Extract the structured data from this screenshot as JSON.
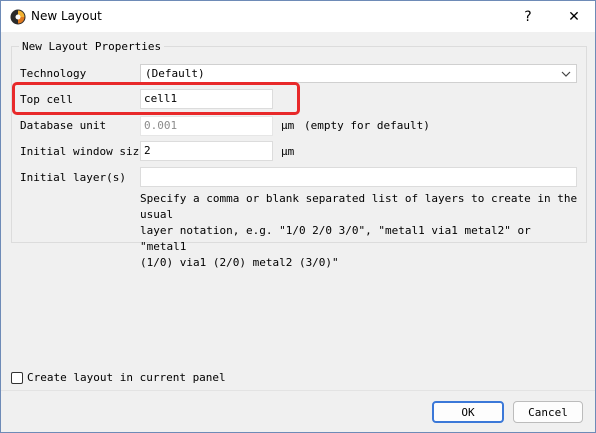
{
  "window": {
    "title": "New Layout",
    "help_glyph": "?",
    "close_glyph": "✕"
  },
  "group": {
    "title": "New Layout Properties"
  },
  "form": {
    "technology_label": "Technology",
    "technology_value": "(Default)",
    "top_cell_label": "Top cell",
    "top_cell_value": "cell1",
    "dbu_label": "Database unit",
    "dbu_placeholder": "0.001",
    "dbu_unit": "µm",
    "dbu_note": "(empty for default)",
    "window_size_label": "Initial window size",
    "window_size_value": "2",
    "window_size_unit": "µm",
    "layers_label": "Initial layer(s)",
    "layers_value": "",
    "layers_hint": "Specify a comma or blank separated list of layers to create in the usual\nlayer notation, e.g. \"1/0 2/0 3/0\", \"metal1 via1 metal2\" or \"metal1\n(1/0) via1 (2/0) metal2 (3/0)\""
  },
  "options": {
    "current_panel_label": "Create layout in current panel",
    "current_panel_checked": false
  },
  "buttons": {
    "ok": "OK",
    "cancel": "Cancel"
  },
  "colors": {
    "highlight": "#e8292a",
    "focus": "#3b78d8"
  },
  "icons": {
    "app": "klayout-app-icon",
    "dropdown": "chevron-down-icon"
  }
}
